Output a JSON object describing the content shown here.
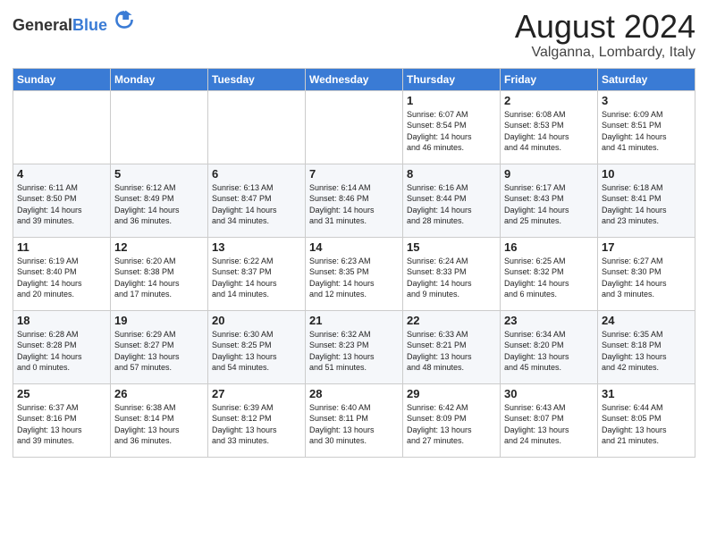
{
  "logo": {
    "general": "General",
    "blue": "Blue"
  },
  "header": {
    "month": "August 2024",
    "location": "Valganna, Lombardy, Italy"
  },
  "weekdays": [
    "Sunday",
    "Monday",
    "Tuesday",
    "Wednesday",
    "Thursday",
    "Friday",
    "Saturday"
  ],
  "weeks": [
    [
      {
        "day": "",
        "content": ""
      },
      {
        "day": "",
        "content": ""
      },
      {
        "day": "",
        "content": ""
      },
      {
        "day": "",
        "content": ""
      },
      {
        "day": "1",
        "content": "Sunrise: 6:07 AM\nSunset: 8:54 PM\nDaylight: 14 hours\nand 46 minutes."
      },
      {
        "day": "2",
        "content": "Sunrise: 6:08 AM\nSunset: 8:53 PM\nDaylight: 14 hours\nand 44 minutes."
      },
      {
        "day": "3",
        "content": "Sunrise: 6:09 AM\nSunset: 8:51 PM\nDaylight: 14 hours\nand 41 minutes."
      }
    ],
    [
      {
        "day": "4",
        "content": "Sunrise: 6:11 AM\nSunset: 8:50 PM\nDaylight: 14 hours\nand 39 minutes."
      },
      {
        "day": "5",
        "content": "Sunrise: 6:12 AM\nSunset: 8:49 PM\nDaylight: 14 hours\nand 36 minutes."
      },
      {
        "day": "6",
        "content": "Sunrise: 6:13 AM\nSunset: 8:47 PM\nDaylight: 14 hours\nand 34 minutes."
      },
      {
        "day": "7",
        "content": "Sunrise: 6:14 AM\nSunset: 8:46 PM\nDaylight: 14 hours\nand 31 minutes."
      },
      {
        "day": "8",
        "content": "Sunrise: 6:16 AM\nSunset: 8:44 PM\nDaylight: 14 hours\nand 28 minutes."
      },
      {
        "day": "9",
        "content": "Sunrise: 6:17 AM\nSunset: 8:43 PM\nDaylight: 14 hours\nand 25 minutes."
      },
      {
        "day": "10",
        "content": "Sunrise: 6:18 AM\nSunset: 8:41 PM\nDaylight: 14 hours\nand 23 minutes."
      }
    ],
    [
      {
        "day": "11",
        "content": "Sunrise: 6:19 AM\nSunset: 8:40 PM\nDaylight: 14 hours\nand 20 minutes."
      },
      {
        "day": "12",
        "content": "Sunrise: 6:20 AM\nSunset: 8:38 PM\nDaylight: 14 hours\nand 17 minutes."
      },
      {
        "day": "13",
        "content": "Sunrise: 6:22 AM\nSunset: 8:37 PM\nDaylight: 14 hours\nand 14 minutes."
      },
      {
        "day": "14",
        "content": "Sunrise: 6:23 AM\nSunset: 8:35 PM\nDaylight: 14 hours\nand 12 minutes."
      },
      {
        "day": "15",
        "content": "Sunrise: 6:24 AM\nSunset: 8:33 PM\nDaylight: 14 hours\nand 9 minutes."
      },
      {
        "day": "16",
        "content": "Sunrise: 6:25 AM\nSunset: 8:32 PM\nDaylight: 14 hours\nand 6 minutes."
      },
      {
        "day": "17",
        "content": "Sunrise: 6:27 AM\nSunset: 8:30 PM\nDaylight: 14 hours\nand 3 minutes."
      }
    ],
    [
      {
        "day": "18",
        "content": "Sunrise: 6:28 AM\nSunset: 8:28 PM\nDaylight: 14 hours\nand 0 minutes."
      },
      {
        "day": "19",
        "content": "Sunrise: 6:29 AM\nSunset: 8:27 PM\nDaylight: 13 hours\nand 57 minutes."
      },
      {
        "day": "20",
        "content": "Sunrise: 6:30 AM\nSunset: 8:25 PM\nDaylight: 13 hours\nand 54 minutes."
      },
      {
        "day": "21",
        "content": "Sunrise: 6:32 AM\nSunset: 8:23 PM\nDaylight: 13 hours\nand 51 minutes."
      },
      {
        "day": "22",
        "content": "Sunrise: 6:33 AM\nSunset: 8:21 PM\nDaylight: 13 hours\nand 48 minutes."
      },
      {
        "day": "23",
        "content": "Sunrise: 6:34 AM\nSunset: 8:20 PM\nDaylight: 13 hours\nand 45 minutes."
      },
      {
        "day": "24",
        "content": "Sunrise: 6:35 AM\nSunset: 8:18 PM\nDaylight: 13 hours\nand 42 minutes."
      }
    ],
    [
      {
        "day": "25",
        "content": "Sunrise: 6:37 AM\nSunset: 8:16 PM\nDaylight: 13 hours\nand 39 minutes."
      },
      {
        "day": "26",
        "content": "Sunrise: 6:38 AM\nSunset: 8:14 PM\nDaylight: 13 hours\nand 36 minutes."
      },
      {
        "day": "27",
        "content": "Sunrise: 6:39 AM\nSunset: 8:12 PM\nDaylight: 13 hours\nand 33 minutes."
      },
      {
        "day": "28",
        "content": "Sunrise: 6:40 AM\nSunset: 8:11 PM\nDaylight: 13 hours\nand 30 minutes."
      },
      {
        "day": "29",
        "content": "Sunrise: 6:42 AM\nSunset: 8:09 PM\nDaylight: 13 hours\nand 27 minutes."
      },
      {
        "day": "30",
        "content": "Sunrise: 6:43 AM\nSunset: 8:07 PM\nDaylight: 13 hours\nand 24 minutes."
      },
      {
        "day": "31",
        "content": "Sunrise: 6:44 AM\nSunset: 8:05 PM\nDaylight: 13 hours\nand 21 minutes."
      }
    ]
  ]
}
